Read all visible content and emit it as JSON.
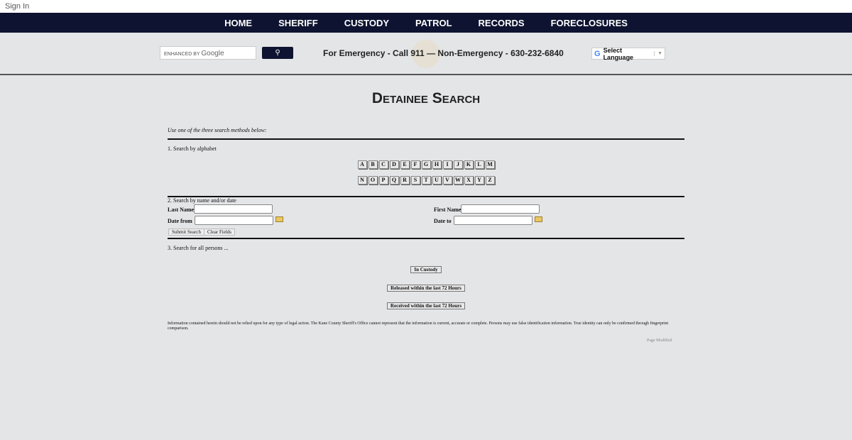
{
  "top": {
    "sign_in": "Sign In"
  },
  "nav": [
    "HOME",
    "SHERIFF",
    "CUSTODY",
    "PATROL",
    "RECORDS",
    "FORECLOSURES"
  ],
  "header": {
    "search_prefix": "ENHANCED BY",
    "search_brand": "Google",
    "search_icon": "search-icon",
    "emergency": "For Emergency - Call 911 — Non-Emergency - 630-232-6840",
    "lang_g": "G",
    "lang": "Select Language",
    "lang_arrow": "▼"
  },
  "page": {
    "title": "Detainee Search",
    "intro": "Use one of the three search methods below:"
  },
  "alpha": {
    "label": "1. Search by alphabet",
    "row1": [
      "A",
      "B",
      "C",
      "D",
      "E",
      "F",
      "G",
      "H",
      "I",
      "J",
      "K",
      "L",
      "M"
    ],
    "row2": [
      "N",
      "O",
      "P",
      "Q",
      "R",
      "S",
      "T",
      "U",
      "V",
      "W",
      "X",
      "Y",
      "Z"
    ]
  },
  "name_search": {
    "label": "2. Search by name and/or date",
    "last_name": "Last Name",
    "first_name": "First Name",
    "date_from": "Date from",
    "date_to": "Date to",
    "submit": "Submit Search",
    "clear": "Clear Fields"
  },
  "all": {
    "label": "3. Search for all persons ...",
    "in_custody": "In Custody",
    "released": "Released within the last 72 Hours",
    "received": "Received within the last 72 Hours"
  },
  "footer": {
    "disclaimer": "Information contained herein should not be relied upon for any type of legal action.  The Kane County Sheriff's Office cannot represent that the information is current, accurate or complete.  Persons may use false identification information.  True identity can only be confirmed through fingerprint comparison.",
    "modified": "Page Modified"
  }
}
